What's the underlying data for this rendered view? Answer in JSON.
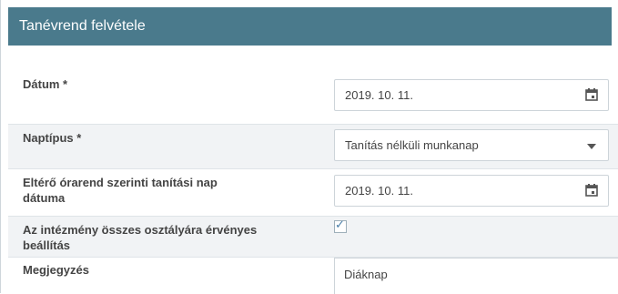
{
  "header": {
    "title": "Tanévrend felvétele"
  },
  "form": {
    "datum": {
      "label": "Dátum *",
      "value": "2019. 10. 11."
    },
    "naptipus": {
      "label": "Naptípus *",
      "value": "Tanítás nélküli munkanap"
    },
    "eltero": {
      "label_line1": "Eltérő órarend szerinti tanítási nap",
      "label_line2": "dátuma",
      "value": "2019. 10. 11."
    },
    "osszes": {
      "label_line1": "Az intézmény összes osztályára érvényes",
      "label_line2": "beállítás",
      "checked": "✓"
    },
    "megjegyzes": {
      "label": "Megjegyzés",
      "value": "Diáknap"
    }
  },
  "icons": {
    "calendar": "calendar-icon",
    "dropdown": "chevron-down-icon",
    "check": "checkmark-icon"
  }
}
